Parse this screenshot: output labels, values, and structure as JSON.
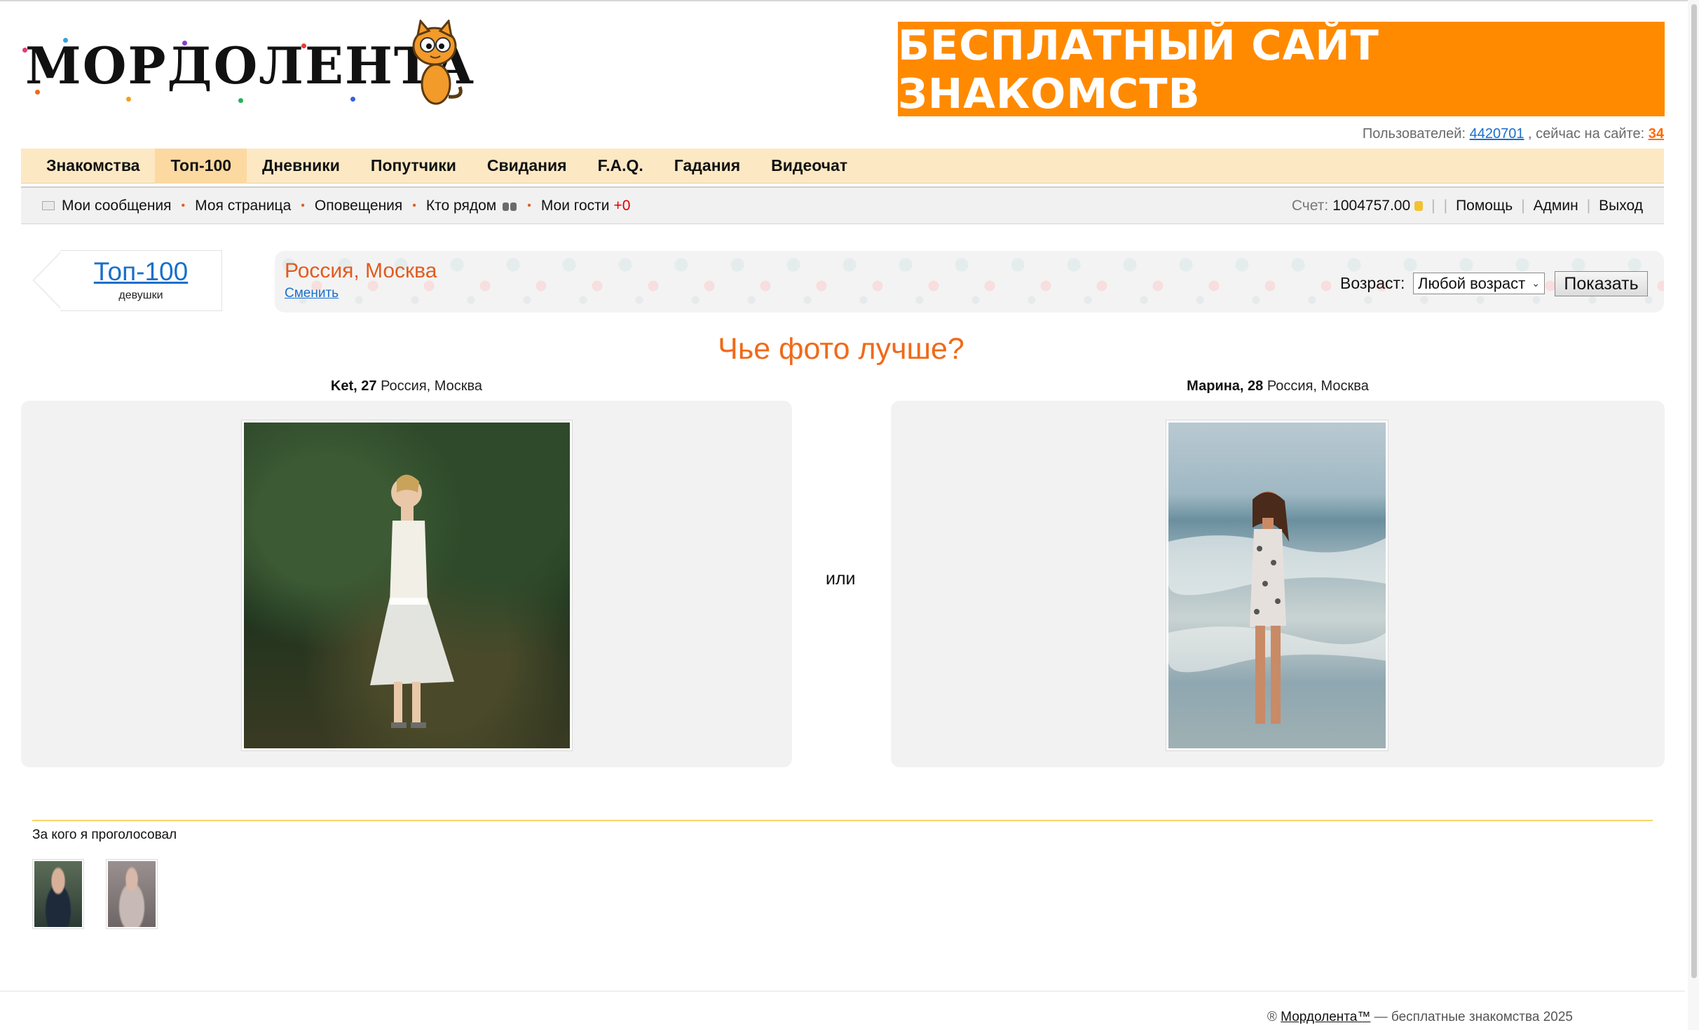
{
  "header": {
    "logo_text": "МОРДОЛЕНТА",
    "banner_text": "БЕСПЛАТНЫЙ САЙТ ЗНАКОМСТВ",
    "users_label": "Пользователей:",
    "users_count": "4420701",
    "online_label": ", сейчас на сайте:",
    "online_count": "34"
  },
  "main_menu": {
    "items": [
      {
        "label": "Знакомства"
      },
      {
        "label": "Топ-100",
        "active": true
      },
      {
        "label": "Дневники"
      },
      {
        "label": "Попутчики"
      },
      {
        "label": "Свидания"
      },
      {
        "label": "F.A.Q."
      },
      {
        "label": "Гадания"
      },
      {
        "label": "Видеочат"
      }
    ]
  },
  "sub_menu": {
    "messages": "Мои сообщения",
    "my_page": "Моя страница",
    "notifications": "Оповещения",
    "nearby": "Кто рядом",
    "guests": "Мои гости",
    "guests_count": "+0",
    "balance_label": "Счет:",
    "balance_value": "1004757.00",
    "help": "Помощь",
    "admin": "Админ",
    "logout": "Выход"
  },
  "filter": {
    "tab_title": "Топ-100",
    "tab_subtitle": "девушки",
    "region": "Россия, Москва",
    "change_link": "Сменить",
    "age_label": "Возраст:",
    "age_selected": "Любой возраст",
    "show_button": "Показать"
  },
  "compare": {
    "title": "Чье фото лучше?",
    "or_label": "или",
    "left": {
      "name": "Ket, 27",
      "location": "Россия, Москва"
    },
    "right": {
      "name": "Марина, 28",
      "location": "Россия, Москва"
    }
  },
  "voted": {
    "title": "За кого я проголосовал"
  },
  "footer": {
    "symbol": "®",
    "brand": "Мордолента™",
    "text": "— бесплатные знакомства 2025"
  },
  "colors": {
    "accent_orange": "#ff8a00",
    "menu_bg": "#fde8c4",
    "link_blue": "#1a6fc9",
    "title_orange": "#f06a1a"
  }
}
